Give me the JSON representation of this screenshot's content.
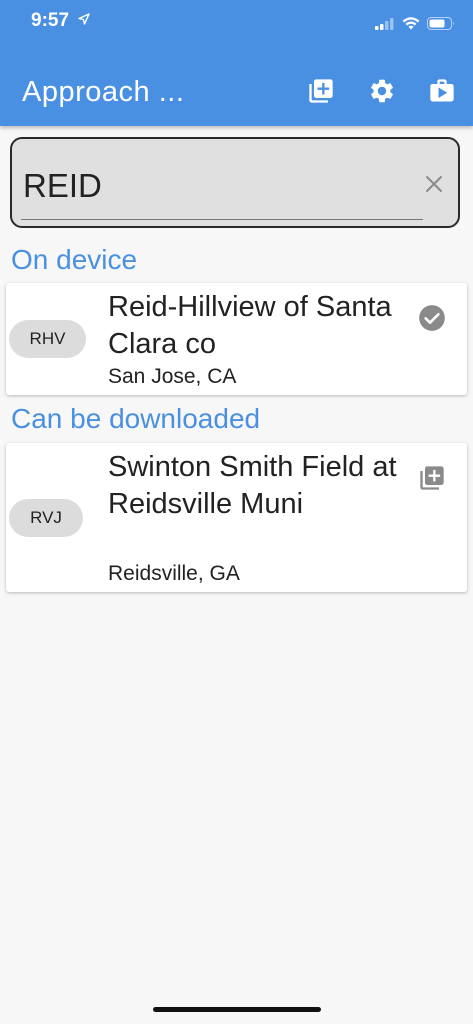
{
  "status_bar": {
    "time": "9:57"
  },
  "app_bar": {
    "title": "Approach ...",
    "actions": [
      {
        "name": "add-box-icon"
      },
      {
        "name": "gear-icon"
      },
      {
        "name": "briefcase-play-icon"
      }
    ],
    "color": "#4a90e2"
  },
  "search": {
    "value": "REID",
    "placeholder": ""
  },
  "sections": {
    "on_device": {
      "header": "On device",
      "items": [
        {
          "code": "RHV",
          "name": "Reid-Hillview of Santa Clara co",
          "city": "San Jose, CA",
          "status_icon": "check-circle-icon"
        }
      ]
    },
    "downloadable": {
      "header": "Can be downloaded",
      "items": [
        {
          "code": "RVJ",
          "name": "Swinton Smith Field at Reidsville Muni",
          "city": "Reidsville, GA",
          "status_icon": "library-add-icon"
        }
      ]
    }
  }
}
